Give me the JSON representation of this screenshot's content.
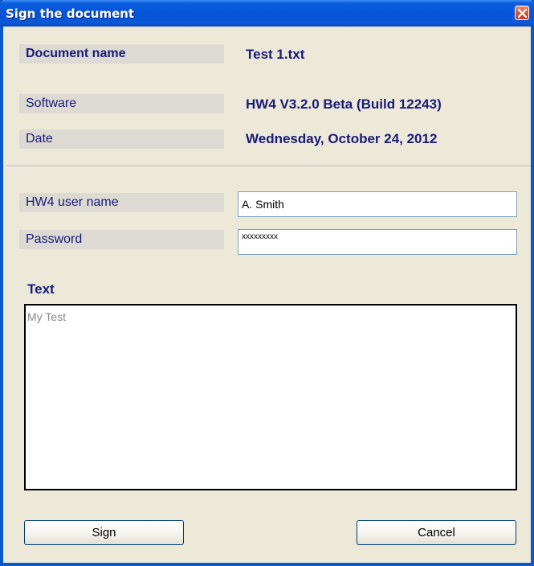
{
  "window": {
    "title": "Sign the document"
  },
  "info": {
    "document_name_label": "Document name",
    "document_name_value": "Test 1.txt",
    "software_label": "Software",
    "software_value": "HW4 V3.2.0 Beta (Build 12243)",
    "date_label": "Date",
    "date_value": "Wednesday, October 24, 2012"
  },
  "form": {
    "username_label": "HW4 user name",
    "username_value": "A. Smith",
    "password_label": "Password",
    "password_value": "xxxxxxxxx",
    "text_label": "Text",
    "text_value": "My Test"
  },
  "buttons": {
    "sign_label": "Sign",
    "cancel_label": "Cancel"
  },
  "colors": {
    "titlebar": "#0753d8",
    "label_text": "#1a1a7a",
    "dialog_bg": "#ece9d8"
  },
  "icons": {
    "close": "close-icon"
  }
}
